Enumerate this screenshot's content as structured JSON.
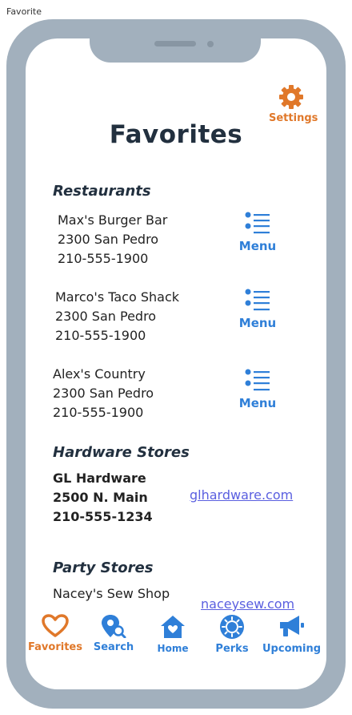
{
  "frame_caption": "Favorite",
  "settings": {
    "label": "Settings",
    "icon": "gear-icon"
  },
  "page_title": "Favorites",
  "sections": {
    "restaurants": {
      "title": "Restaurants",
      "items": [
        {
          "name": "Max's Burger Bar",
          "address": "2300 San Pedro",
          "phone": "210-555-1900",
          "action": "Menu"
        },
        {
          "name": "Marco's Taco Shack",
          "address": "2300 San Pedro",
          "phone": "210-555-1900",
          "action": "Menu"
        },
        {
          "name": "Alex's Country",
          "address": "2300 San Pedro",
          "phone": "210-555-1900",
          "action": "Menu"
        }
      ]
    },
    "hardware": {
      "title": "Hardware Stores",
      "items": [
        {
          "name": "GL Hardware",
          "address": "2500 N. Main",
          "phone": "210-555-1234",
          "link": "glhardware.com"
        }
      ]
    },
    "party": {
      "title": "Party Stores",
      "items": [
        {
          "name": "Nacey's Sew Shop",
          "link": "naceysew.com"
        }
      ]
    }
  },
  "nav": [
    {
      "label": "Favorites",
      "icon": "heart-icon",
      "active": true
    },
    {
      "label": "Search",
      "icon": "map-pin-search-icon",
      "active": false
    },
    {
      "label": "Home",
      "icon": "home-icon",
      "active": false
    },
    {
      "label": "Perks",
      "icon": "badge-icon",
      "active": false
    },
    {
      "label": "Upcoming",
      "icon": "megaphone-icon",
      "active": false
    }
  ],
  "colors": {
    "accent": "#e0782a",
    "primary": "#2f7fd8",
    "heading": "#22303f",
    "link": "#5a5fe0",
    "frame": "#a2b0bd"
  }
}
